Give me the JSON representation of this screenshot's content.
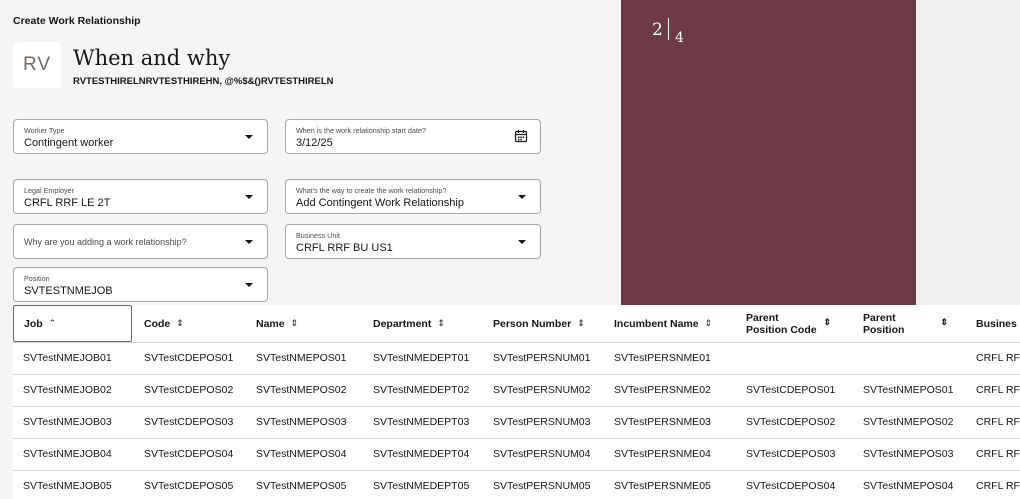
{
  "header": {
    "page_title": "Create Work Relationship",
    "avatar_initials": "RV",
    "heading": "When and why",
    "person_name": "RVTESTHIRELNRVTESTHIREHN, @%$&()RVTESTHIRELN"
  },
  "form": {
    "worker_type": {
      "label": "Worker Type",
      "value": "Contingent worker"
    },
    "start_date": {
      "label": "When is the work relationship start date?",
      "value": "3/12/25"
    },
    "legal_employer": {
      "label": "Legal Employer",
      "value": "CRFL RRF LE 2T"
    },
    "create_way": {
      "label": "What's the way to create the work relationship?",
      "value": "Add Contingent Work Relationship"
    },
    "reason": {
      "placeholder": "Why are you adding a work relationship?"
    },
    "business_unit": {
      "label": "Business Unit",
      "value": "CRFL RRF BU US1"
    },
    "position": {
      "label": "Position",
      "value": "SVTESTNMEJOB"
    }
  },
  "steps": {
    "current": "2",
    "total": "4"
  },
  "table": {
    "columns": [
      "Job",
      "Code",
      "Name",
      "Department",
      "Person Number",
      "Incumbent Name",
      "Parent Position Code",
      "Parent Position",
      "Busines"
    ],
    "rows": [
      [
        "SVTestNMEJOB01",
        "SVTestCDEPOS01",
        "SVTestNMEPOS01",
        "SVTestNMEDEPT01",
        "SVTestPERSNUM01",
        "SVTestPERSNME01",
        "",
        "",
        "CRFL RF"
      ],
      [
        "SVTestNMEJOB02",
        "SVTestCDEPOS02",
        "SVTestNMEPOS02",
        "SVTestNMEDEPT02",
        "SVTestPERSNUM02",
        "SVTestPERSNME02",
        "SVTestCDEPOS01",
        "SVTestNMEPOS01",
        "CRFL RF"
      ],
      [
        "SVTestNMEJOB03",
        "SVTestCDEPOS03",
        "SVTestNMEPOS03",
        "SVTestNMEDEPT03",
        "SVTestPERSNUM03",
        "SVTestPERSNME03",
        "SVTestCDEPOS02",
        "SVTestNMEPOS02",
        "CRFL RF"
      ],
      [
        "SVTestNMEJOB04",
        "SVTestCDEPOS04",
        "SVTestNMEPOS04",
        "SVTestNMEDEPT04",
        "SVTestPERSNUM04",
        "SVTestPERSNME04",
        "SVTestCDEPOS03",
        "SVTestNMEPOS03",
        "CRFL RF"
      ],
      [
        "SVTestNMEJOB05",
        "SVTestCDEPOS05",
        "SVTestNMEPOS05",
        "SVTestNMEDEPT05",
        "SVTestPERSNUM05",
        "SVTestPERSNME05",
        "SVTestCDEPOS04",
        "SVTestNMEPOS04",
        "CRFL RF"
      ]
    ]
  },
  "colors": {
    "side_panel": "#6e3a45",
    "background": "#f7f5f4"
  },
  "icons": {
    "sort_asc": "chevron-up-icon",
    "sort_both": "sort-icon",
    "dropdown": "chevron-down-icon",
    "calendar": "calendar-icon"
  }
}
